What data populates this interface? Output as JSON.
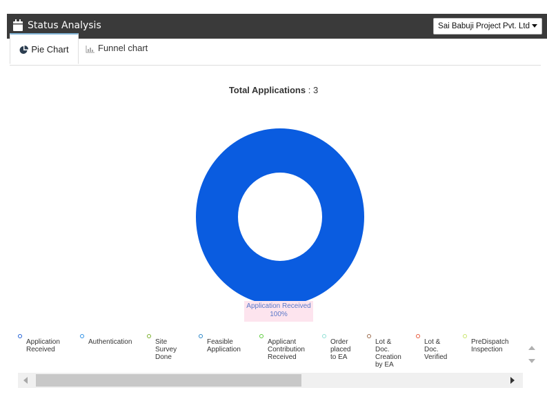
{
  "header": {
    "title": "Status Analysis",
    "company": "Sai Babuji Project Pvt. Ltd"
  },
  "tabs": [
    {
      "label": "Pie Chart",
      "active": true,
      "icon": "pie-chart-icon"
    },
    {
      "label": "Funnel chart",
      "active": false,
      "icon": "funnel-chart-icon"
    }
  ],
  "summary": {
    "label": "Total Applications",
    "separator": ":",
    "value": "3"
  },
  "colors": {
    "header_bg": "#3a3a3a",
    "slice": "#0a5ce0",
    "slice_label_bg": "#fde4ee",
    "active_tab_border": "#7fb3d5"
  },
  "chart_data": {
    "type": "pie",
    "donut": true,
    "slices": [
      {
        "label": "Application Received",
        "value": 100,
        "percent": "100%",
        "color": "#0a5ce0"
      }
    ],
    "legend": [
      {
        "lines": [
          "Application",
          "Received"
        ],
        "color": "#1f5fd6"
      },
      {
        "lines": [
          "Authentication"
        ],
        "color": "#2a8fe6"
      },
      {
        "lines": [
          "Site",
          "Survey",
          "Done"
        ],
        "color": "#7ab02a"
      },
      {
        "lines": [
          "Feasible",
          "Application"
        ],
        "color": "#2a86c8"
      },
      {
        "lines": [
          "Applicant",
          "Contribution",
          "Received"
        ],
        "color": "#5ccc3c"
      },
      {
        "lines": [
          "Order",
          "placed",
          "to EA"
        ],
        "color": "#8ee0d4"
      },
      {
        "lines": [
          "Lot &",
          "Doc.",
          "Creation",
          "by EA"
        ],
        "color": "#9a6a4a"
      },
      {
        "lines": [
          "Lot &",
          "Doc.",
          "Verified"
        ],
        "color": "#e8583a"
      },
      {
        "lines": [
          "PreDispatch",
          "Inspection"
        ],
        "color": "#c8e66a"
      }
    ]
  }
}
